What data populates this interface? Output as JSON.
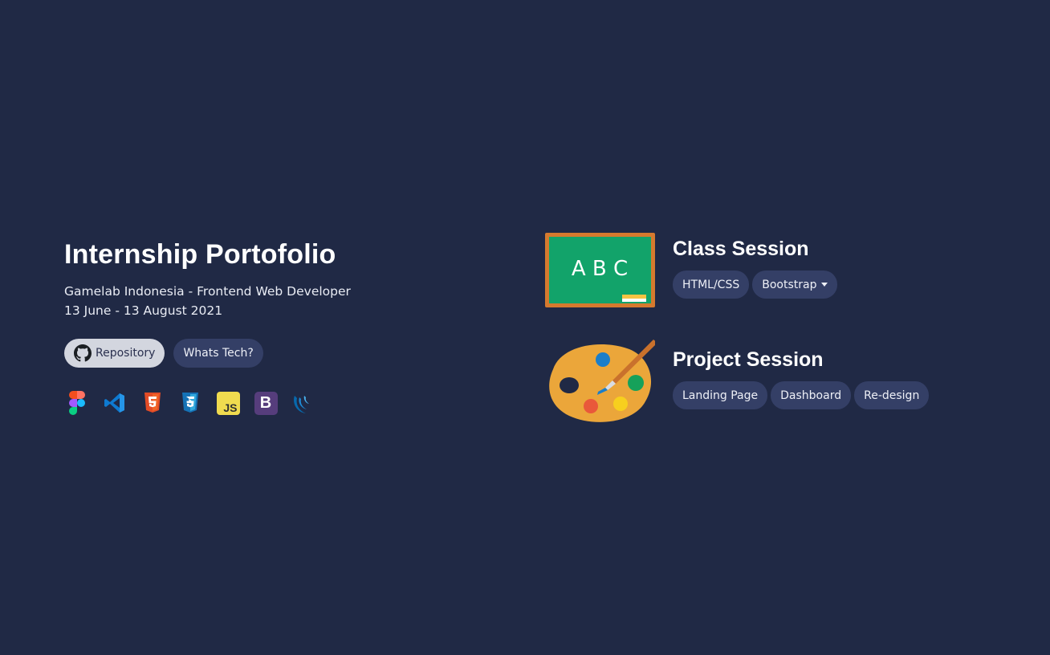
{
  "hero": {
    "title": "Internship Portofolio",
    "subtitle_line1": "Gamelab Indonesia - Frontend Web Developer",
    "subtitle_line2": "13 June - 13 August 2021",
    "buttons": {
      "repository": "Repository",
      "whats_tech": "Whats Tech?"
    },
    "tech_icons": [
      "figma-icon",
      "vscode-icon",
      "html5-icon",
      "css3-icon",
      "javascript-icon",
      "bootstrap-icon",
      "jquery-icon"
    ],
    "tech_icon_text": {
      "js": "JS",
      "bootstrap": "B"
    }
  },
  "sessions": {
    "class": {
      "title": "Class Session",
      "board_text": "A B C",
      "tags": [
        "HTML/CSS",
        "Bootstrap"
      ]
    },
    "project": {
      "title": "Project Session",
      "tags": [
        "Landing Page",
        "Dashboard",
        "Re-design"
      ]
    }
  },
  "colors": {
    "background": "#202945",
    "pill": "#343f66",
    "pill_light": "#d3d6df"
  }
}
